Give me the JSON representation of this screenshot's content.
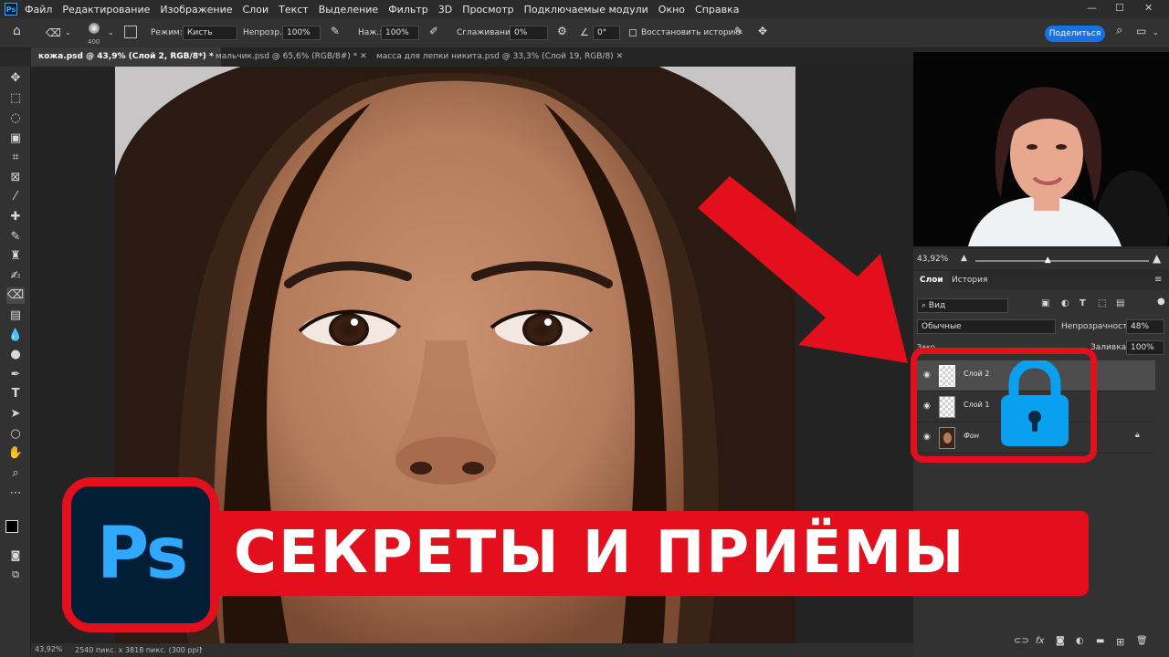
{
  "menu": {
    "app_icon": "Ps",
    "items": [
      "Файл",
      "Редактирование",
      "Изображение",
      "Слои",
      "Текст",
      "Выделение",
      "Фильтр",
      "3D",
      "Просмотр",
      "Подключаемые модули",
      "Окно",
      "Справка"
    ]
  },
  "options": {
    "brush_size": "400",
    "mode_label": "Режим:",
    "mode_value": "Кисть",
    "opacity_label": "Непрозр.:",
    "opacity_value": "100%",
    "pressure_label": "Наж.:",
    "pressure_value": "100%",
    "smoothing_label": "Сглаживание:",
    "smoothing_value": "0%",
    "angle_value": "0°",
    "restore_history_label": "Восстановить историю",
    "share_label": "Поделиться"
  },
  "tabs": [
    {
      "label": "кожа.psd @ 43,9% (Слой 2, RGB/8*) *",
      "active": true
    },
    {
      "label": "мальчик.psd @ 65,6% (RGB/8#) *",
      "active": false
    },
    {
      "label": "масса для лепки никита.psd @ 33,3% (Слой 19, RGB/8)",
      "active": false
    }
  ],
  "status": {
    "zoom": "43,92%",
    "doc_info": "2540 пикс. x 3818 пикс. (300 ppi)"
  },
  "navigator": {
    "zoom": "43,92%",
    "slider_fraction": 0.42
  },
  "layers_panel": {
    "tabs": [
      "Слои",
      "История"
    ],
    "filter_label": "Вид",
    "blend_mode": "Обычные",
    "opacity_label": "Непрозрачность:",
    "opacity_value": "48%",
    "fill_label": "Заливка:",
    "fill_value": "100%",
    "lock_label": "Закр.",
    "layers": [
      {
        "name": "Слой 2",
        "selected": true
      },
      {
        "name": "Слой 1",
        "selected": false
      },
      {
        "name": "Фон",
        "selected": false,
        "locked": true
      }
    ]
  },
  "overlay": {
    "logo_text": "Ps",
    "banner_text": "СЕКРЕТЫ И ПРИЁМЫ"
  },
  "colors": {
    "accent_red": "#e30f1c",
    "ps_blue": "#31a8ff",
    "ps_navy": "#001e36",
    "lock_blue": "#0aa0f0",
    "share_blue": "#1473e6"
  }
}
